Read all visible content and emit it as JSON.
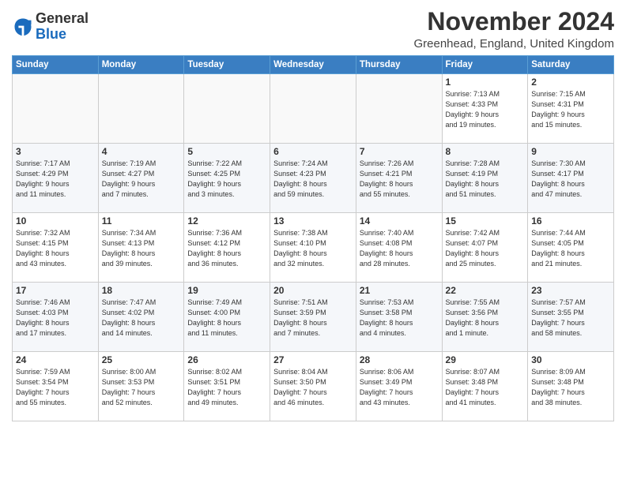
{
  "logo": {
    "line1": "General",
    "line2": "Blue"
  },
  "header": {
    "title": "November 2024",
    "location": "Greenhead, England, United Kingdom"
  },
  "days": [
    "Sunday",
    "Monday",
    "Tuesday",
    "Wednesday",
    "Thursday",
    "Friday",
    "Saturday"
  ],
  "weeks": [
    [
      {
        "day": "",
        "info": ""
      },
      {
        "day": "",
        "info": ""
      },
      {
        "day": "",
        "info": ""
      },
      {
        "day": "",
        "info": ""
      },
      {
        "day": "",
        "info": ""
      },
      {
        "day": "1",
        "info": "Sunrise: 7:13 AM\nSunset: 4:33 PM\nDaylight: 9 hours\nand 19 minutes."
      },
      {
        "day": "2",
        "info": "Sunrise: 7:15 AM\nSunset: 4:31 PM\nDaylight: 9 hours\nand 15 minutes."
      }
    ],
    [
      {
        "day": "3",
        "info": "Sunrise: 7:17 AM\nSunset: 4:29 PM\nDaylight: 9 hours\nand 11 minutes."
      },
      {
        "day": "4",
        "info": "Sunrise: 7:19 AM\nSunset: 4:27 PM\nDaylight: 9 hours\nand 7 minutes."
      },
      {
        "day": "5",
        "info": "Sunrise: 7:22 AM\nSunset: 4:25 PM\nDaylight: 9 hours\nand 3 minutes."
      },
      {
        "day": "6",
        "info": "Sunrise: 7:24 AM\nSunset: 4:23 PM\nDaylight: 8 hours\nand 59 minutes."
      },
      {
        "day": "7",
        "info": "Sunrise: 7:26 AM\nSunset: 4:21 PM\nDaylight: 8 hours\nand 55 minutes."
      },
      {
        "day": "8",
        "info": "Sunrise: 7:28 AM\nSunset: 4:19 PM\nDaylight: 8 hours\nand 51 minutes."
      },
      {
        "day": "9",
        "info": "Sunrise: 7:30 AM\nSunset: 4:17 PM\nDaylight: 8 hours\nand 47 minutes."
      }
    ],
    [
      {
        "day": "10",
        "info": "Sunrise: 7:32 AM\nSunset: 4:15 PM\nDaylight: 8 hours\nand 43 minutes."
      },
      {
        "day": "11",
        "info": "Sunrise: 7:34 AM\nSunset: 4:13 PM\nDaylight: 8 hours\nand 39 minutes."
      },
      {
        "day": "12",
        "info": "Sunrise: 7:36 AM\nSunset: 4:12 PM\nDaylight: 8 hours\nand 36 minutes."
      },
      {
        "day": "13",
        "info": "Sunrise: 7:38 AM\nSunset: 4:10 PM\nDaylight: 8 hours\nand 32 minutes."
      },
      {
        "day": "14",
        "info": "Sunrise: 7:40 AM\nSunset: 4:08 PM\nDaylight: 8 hours\nand 28 minutes."
      },
      {
        "day": "15",
        "info": "Sunrise: 7:42 AM\nSunset: 4:07 PM\nDaylight: 8 hours\nand 25 minutes."
      },
      {
        "day": "16",
        "info": "Sunrise: 7:44 AM\nSunset: 4:05 PM\nDaylight: 8 hours\nand 21 minutes."
      }
    ],
    [
      {
        "day": "17",
        "info": "Sunrise: 7:46 AM\nSunset: 4:03 PM\nDaylight: 8 hours\nand 17 minutes."
      },
      {
        "day": "18",
        "info": "Sunrise: 7:47 AM\nSunset: 4:02 PM\nDaylight: 8 hours\nand 14 minutes."
      },
      {
        "day": "19",
        "info": "Sunrise: 7:49 AM\nSunset: 4:00 PM\nDaylight: 8 hours\nand 11 minutes."
      },
      {
        "day": "20",
        "info": "Sunrise: 7:51 AM\nSunset: 3:59 PM\nDaylight: 8 hours\nand 7 minutes."
      },
      {
        "day": "21",
        "info": "Sunrise: 7:53 AM\nSunset: 3:58 PM\nDaylight: 8 hours\nand 4 minutes."
      },
      {
        "day": "22",
        "info": "Sunrise: 7:55 AM\nSunset: 3:56 PM\nDaylight: 8 hours\nand 1 minute."
      },
      {
        "day": "23",
        "info": "Sunrise: 7:57 AM\nSunset: 3:55 PM\nDaylight: 7 hours\nand 58 minutes."
      }
    ],
    [
      {
        "day": "24",
        "info": "Sunrise: 7:59 AM\nSunset: 3:54 PM\nDaylight: 7 hours\nand 55 minutes."
      },
      {
        "day": "25",
        "info": "Sunrise: 8:00 AM\nSunset: 3:53 PM\nDaylight: 7 hours\nand 52 minutes."
      },
      {
        "day": "26",
        "info": "Sunrise: 8:02 AM\nSunset: 3:51 PM\nDaylight: 7 hours\nand 49 minutes."
      },
      {
        "day": "27",
        "info": "Sunrise: 8:04 AM\nSunset: 3:50 PM\nDaylight: 7 hours\nand 46 minutes."
      },
      {
        "day": "28",
        "info": "Sunrise: 8:06 AM\nSunset: 3:49 PM\nDaylight: 7 hours\nand 43 minutes."
      },
      {
        "day": "29",
        "info": "Sunrise: 8:07 AM\nSunset: 3:48 PM\nDaylight: 7 hours\nand 41 minutes."
      },
      {
        "day": "30",
        "info": "Sunrise: 8:09 AM\nSunset: 3:48 PM\nDaylight: 7 hours\nand 38 minutes."
      }
    ]
  ]
}
